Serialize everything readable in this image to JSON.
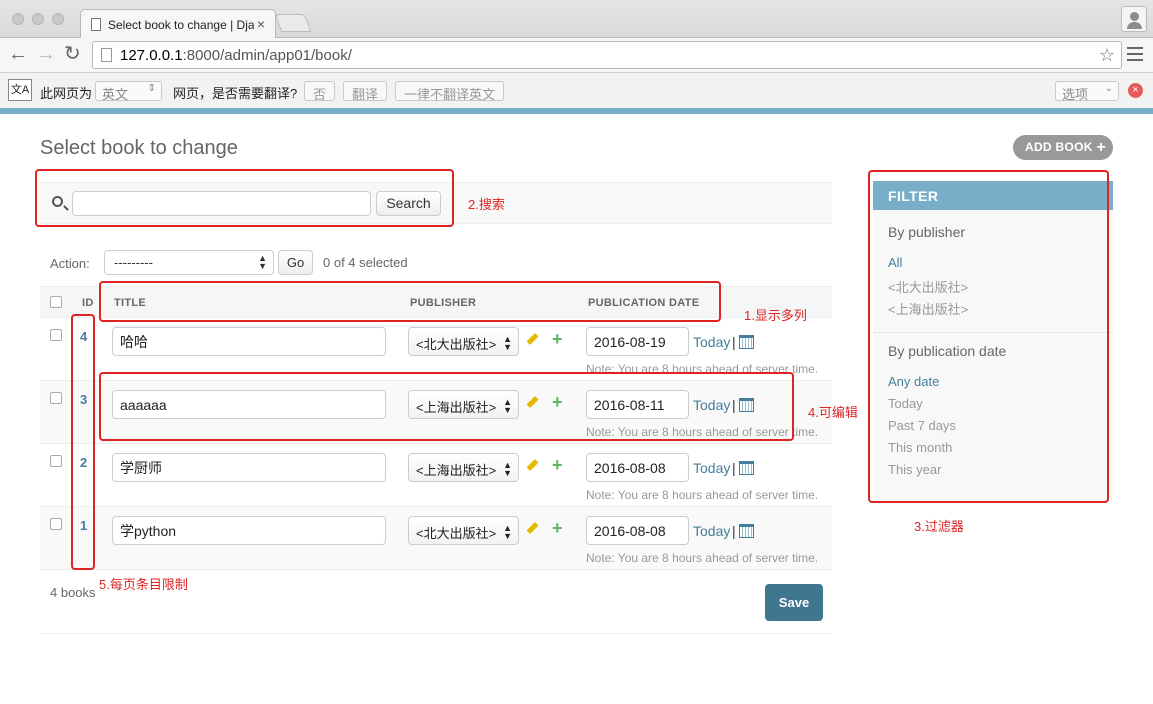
{
  "browser": {
    "tab_title": "Select book to change | Dja",
    "tab_close": "×",
    "url_host": "127.0.0.1",
    "url_rest": ":8000/admin/app01/book/",
    "star": "☆"
  },
  "translate_bar": {
    "icon": "文A",
    "prefix": "此网页为",
    "language": "英文",
    "question": "网页，是否需要翻译?",
    "no_btn": "否",
    "translate_btn": "翻译",
    "never_btn": "一律不翻译英文",
    "options": "选项",
    "close": "×"
  },
  "page": {
    "title": "Select book to change",
    "add_button": "ADD BOOK",
    "add_plus": "+"
  },
  "search": {
    "value": "",
    "button": "Search"
  },
  "actions": {
    "label": "Action:",
    "selected": "---------",
    "go": "Go",
    "count": "0 of 4 selected"
  },
  "table": {
    "columns": [
      "ID",
      "TITLE",
      "PUBLISHER",
      "PUBLICATION DATE"
    ],
    "rows": [
      {
        "id": "4",
        "title": "哈哈",
        "publisher": "<北大出版社>",
        "date": "2016-08-19"
      },
      {
        "id": "3",
        "title": "aaaaaa",
        "publisher": "<上海出版社>",
        "date": "2016-08-11"
      },
      {
        "id": "2",
        "title": "学厨师",
        "publisher": "<上海出版社>",
        "date": "2016-08-08"
      },
      {
        "id": "1",
        "title": "学python",
        "publisher": "<北大出版社>",
        "date": "2016-08-08"
      }
    ],
    "today": "Today",
    "separator": "|",
    "note": "Note: You are 8 hours ahead of server time."
  },
  "footer": {
    "count": "4 books",
    "save": "Save"
  },
  "filter": {
    "title": "FILTER",
    "publisher_heading": "By publisher",
    "publisher_items": [
      "All",
      "<北大出版社>",
      "<上海出版社>"
    ],
    "date_heading": "By publication date",
    "date_items": [
      "Any date",
      "Today",
      "Past 7 days",
      "This month",
      "This year"
    ]
  },
  "annotations": {
    "search": "2.搜索",
    "columns": "1.显示多列",
    "editable": "4.可编辑",
    "filter": "3.过滤器",
    "per_page": "5.每页条目限制"
  },
  "colors": {
    "accent": "#79aec8",
    "link": "#447e9b",
    "save": "#417690",
    "annotation": "#e02424"
  }
}
